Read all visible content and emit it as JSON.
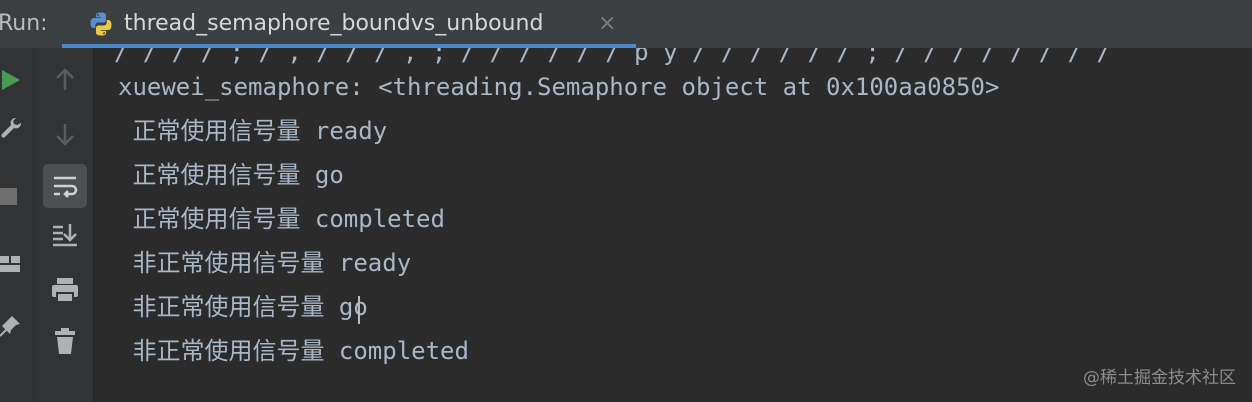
{
  "header": {
    "run_label": "Run:",
    "tab": {
      "title": "thread_semaphore_boundvs_unbound",
      "close": "×",
      "icon": "python-icon"
    }
  },
  "left_toolbar": {
    "outer": [
      "run-icon",
      "wrench-icon",
      "stop-icon",
      "layout-icon",
      "pin-icon"
    ],
    "inner": [
      "arrow-up-icon",
      "arrow-down-icon",
      "soft-wrap-icon",
      "scroll-to-end-icon",
      "print-icon",
      "trash-icon"
    ],
    "active": "soft-wrap-icon"
  },
  "console": {
    "cut_line": "/ / / / ; / , / / / , ; / / / / / / p y / / / / / / ; / / / / / / / /",
    "lines": [
      "xuewei_semaphore: <threading.Semaphore object at 0x100aa0850>",
      " 正常使用信号量 ready",
      " 正常使用信号量 go",
      " 正常使用信号量 completed",
      " 非正常使用信号量 ready",
      " 非正常使用信号量 go",
      " 非正常使用信号量 completed"
    ]
  },
  "watermark": "@稀土掘金技术社区",
  "colors": {
    "header_bg": "#3c3f41",
    "console_bg": "#2b2b2b",
    "text": "#a9b7c6",
    "accent": "#4a88c7",
    "run_green": "#499c54"
  }
}
